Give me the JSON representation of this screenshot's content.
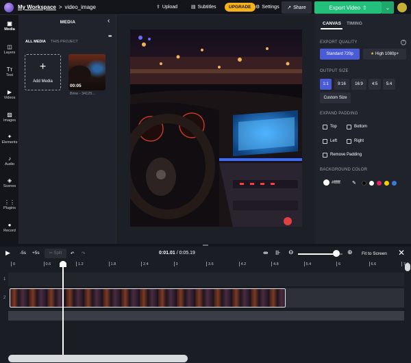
{
  "header": {
    "workspace": "My Workspace",
    "separator": ">",
    "project": "video_image",
    "upload": "Upload",
    "subtitles": "Subtitles",
    "upgrade": "UPGRADE",
    "settings": "Settings",
    "share": "Share",
    "export": "Export Video",
    "icons": {
      "upload": "upload-icon",
      "subtitles": "subtitles-icon",
      "settings": "gear-icon",
      "share": "share-icon",
      "export": "export-icon",
      "menu": "chevron-down-icon"
    }
  },
  "rail": {
    "items": [
      {
        "label": "Media",
        "icon": "media-icon"
      },
      {
        "label": "Layers",
        "icon": "layers-icon"
      },
      {
        "label": "Text",
        "icon": "text-icon"
      },
      {
        "label": "Videos",
        "icon": "videos-icon"
      },
      {
        "label": "Images",
        "icon": "images-icon"
      },
      {
        "label": "Elements",
        "icon": "elements-icon"
      },
      {
        "label": "Audio",
        "icon": "audio-icon"
      },
      {
        "label": "Scenes",
        "icon": "scenes-icon"
      },
      {
        "label": "Plugins",
        "icon": "plugins-icon"
      },
      {
        "label": "Record",
        "icon": "record-icon"
      }
    ]
  },
  "media": {
    "title": "MEDIA",
    "tab_all": "ALL MEDIA",
    "tab_this": "THIS PROJECT",
    "add": "Add Media",
    "thumb_duration": "00:05",
    "thumb_name": "Bmw - 34125..."
  },
  "panel": {
    "tab_canvas": "CANVAS",
    "tab_timing": "TIMING",
    "export_quality": "EXPORT QUALITY",
    "standard": "Standard 720p",
    "high": "High 1080p+",
    "output_size": "OUTPUT SIZE",
    "ratios": [
      "1:1",
      "9:16",
      "16:9",
      "4:5",
      "5:4"
    ],
    "custom_size": "Custom Size",
    "expand_padding": "EXPAND PADDING",
    "top": "Top",
    "bottom": "Bottom",
    "left": "Left",
    "right": "Right",
    "remove_padding": "Remove Padding",
    "background_color": "BACKGROUND COLOR",
    "hex": "#ffffff",
    "colors": [
      "#000000",
      "#ffffff",
      "#e0245e",
      "#f5d000",
      "#3a7bd5"
    ]
  },
  "timeline": {
    "back": "-5s",
    "fwd": "+5s",
    "split": "Split",
    "current": "0:01.01",
    "total": "/ 0:05.19",
    "fit": "Fit to Screen",
    "ticks": [
      "0",
      "0.6",
      "1.2",
      "1.8",
      "2.4",
      "3",
      "3.6",
      "4.2",
      "4.8",
      "5.4",
      "6",
      "6.6",
      "7.2"
    ],
    "tracks": [
      "1",
      "2"
    ]
  }
}
